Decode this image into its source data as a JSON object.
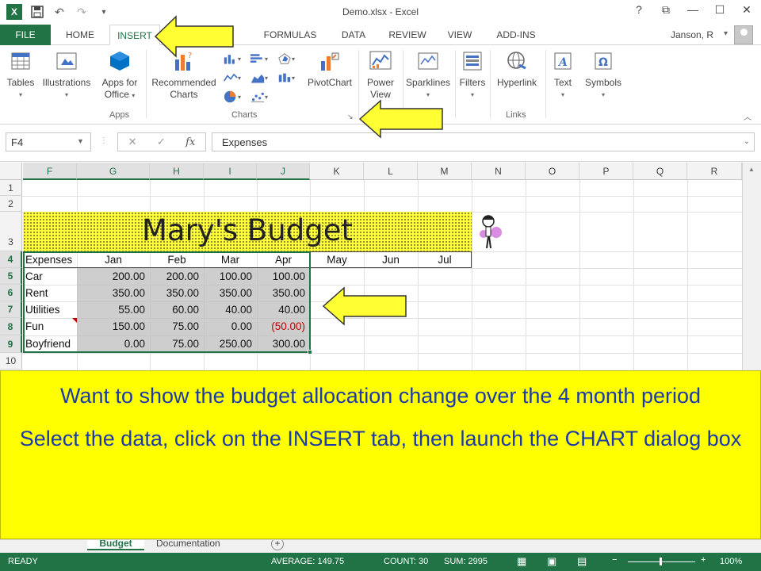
{
  "window": {
    "title": "Demo.xlsx - Excel",
    "controls": {
      "help": "?",
      "restore": "⧉",
      "minimize": "—",
      "maximize": "☐",
      "close": "✕"
    }
  },
  "quick_access": {
    "logo": "X",
    "save": "💾",
    "undo": "↶",
    "redo": "↷",
    "customize": "▾"
  },
  "tabs": [
    {
      "label": "FILE"
    },
    {
      "label": "HOME"
    },
    {
      "label": "INSERT"
    },
    {
      "label": "FORMULAS"
    },
    {
      "label": "DATA"
    },
    {
      "label": "REVIEW"
    },
    {
      "label": "VIEW"
    },
    {
      "label": "ADD-INS"
    }
  ],
  "user": {
    "name": "Janson, R"
  },
  "ribbon": {
    "tables": "Tables",
    "illustrations": "Illustrations",
    "apps_for_office_1": "Apps for",
    "apps_for_office_2": "Office",
    "recommended_charts_1": "Recommended",
    "recommended_charts_2": "Charts",
    "pivotchart": "PivotChart",
    "power_view_1": "Power",
    "power_view_2": "View",
    "sparklines": "Sparklines",
    "filters": "Filters",
    "hyperlink": "Hyperlink",
    "text": "Text",
    "symbols": "Symbols",
    "groups": {
      "apps": "Apps",
      "charts": "Charts",
      "links": "Links"
    }
  },
  "formula_bar": {
    "name_box": "F4",
    "formula": "Expenses",
    "fx": "fx"
  },
  "columns": [
    "F",
    "G",
    "H",
    "I",
    "J",
    "K",
    "L",
    "M",
    "N",
    "O",
    "P",
    "Q",
    "R"
  ],
  "rows": [
    "1",
    "2",
    "3",
    "4",
    "5",
    "6",
    "7",
    "8",
    "9",
    "10"
  ],
  "sheet": {
    "title": "Mary's Budget",
    "headers": [
      "Expenses",
      "Jan",
      "Feb",
      "Mar",
      "Apr",
      "May",
      "Jun",
      "Jul"
    ],
    "data": [
      {
        "label": "Car",
        "values": [
          "200.00",
          "200.00",
          "100.00",
          "100.00"
        ]
      },
      {
        "label": "Rent",
        "values": [
          "350.00",
          "350.00",
          "350.00",
          "350.00"
        ]
      },
      {
        "label": "Utilities",
        "values": [
          "55.00",
          "60.00",
          "40.00",
          "40.00"
        ]
      },
      {
        "label": "Fun",
        "values": [
          "150.00",
          "75.00",
          "0.00",
          "(50.00)"
        ]
      },
      {
        "label": "Boyfriend",
        "values": [
          "0.00",
          "75.00",
          "250.00",
          "300.00"
        ]
      }
    ]
  },
  "callout": {
    "line1": "Want to show the budget allocation change over the 4 month period",
    "line2": "Select the data, click on the INSERT tab, then launch the CHART dialog box"
  },
  "sheet_tabs": {
    "active": "Budget",
    "other": "Documentation",
    "add": "+"
  },
  "status": {
    "ready": "READY",
    "average": "AVERAGE: 149.75",
    "count": "COUNT: 30",
    "sum": "SUM: 2995",
    "zoom": "100%",
    "zoom_minus": "−",
    "zoom_plus": "+"
  },
  "colors": {
    "excel_green": "#217346",
    "callout_yellow": "#ffff00",
    "callout_text": "#1c3aa9",
    "arrow_yellow": "#ffff33",
    "negative_red": "#c00000"
  }
}
